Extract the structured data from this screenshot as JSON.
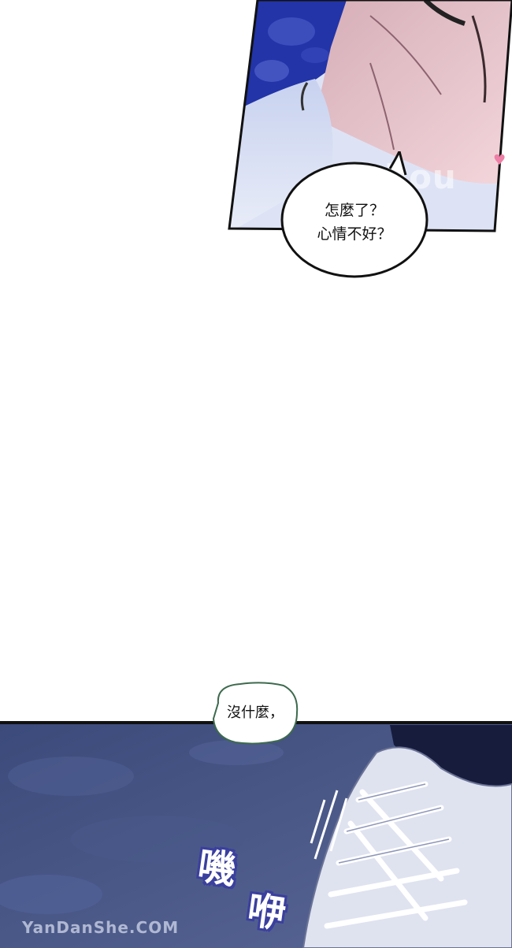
{
  "top_panel": {
    "speech_bubble": {
      "lines": "怎麼了？\n心情不好？"
    },
    "watermark": "fuhou",
    "heart_icon": "heart-icon"
  },
  "bottom_panel": {
    "speech_bubble": {
      "text": "沒什麼，"
    },
    "sound_effect": {
      "part1": "嘰",
      "part2": "咿"
    },
    "watermark": "YanDanShe.COM"
  },
  "colors": {
    "panel_border": "#111111",
    "sky_blue": "#2a3fb0",
    "sfx_outline": "#3b3f9e",
    "heart": "#ef7fa6"
  }
}
